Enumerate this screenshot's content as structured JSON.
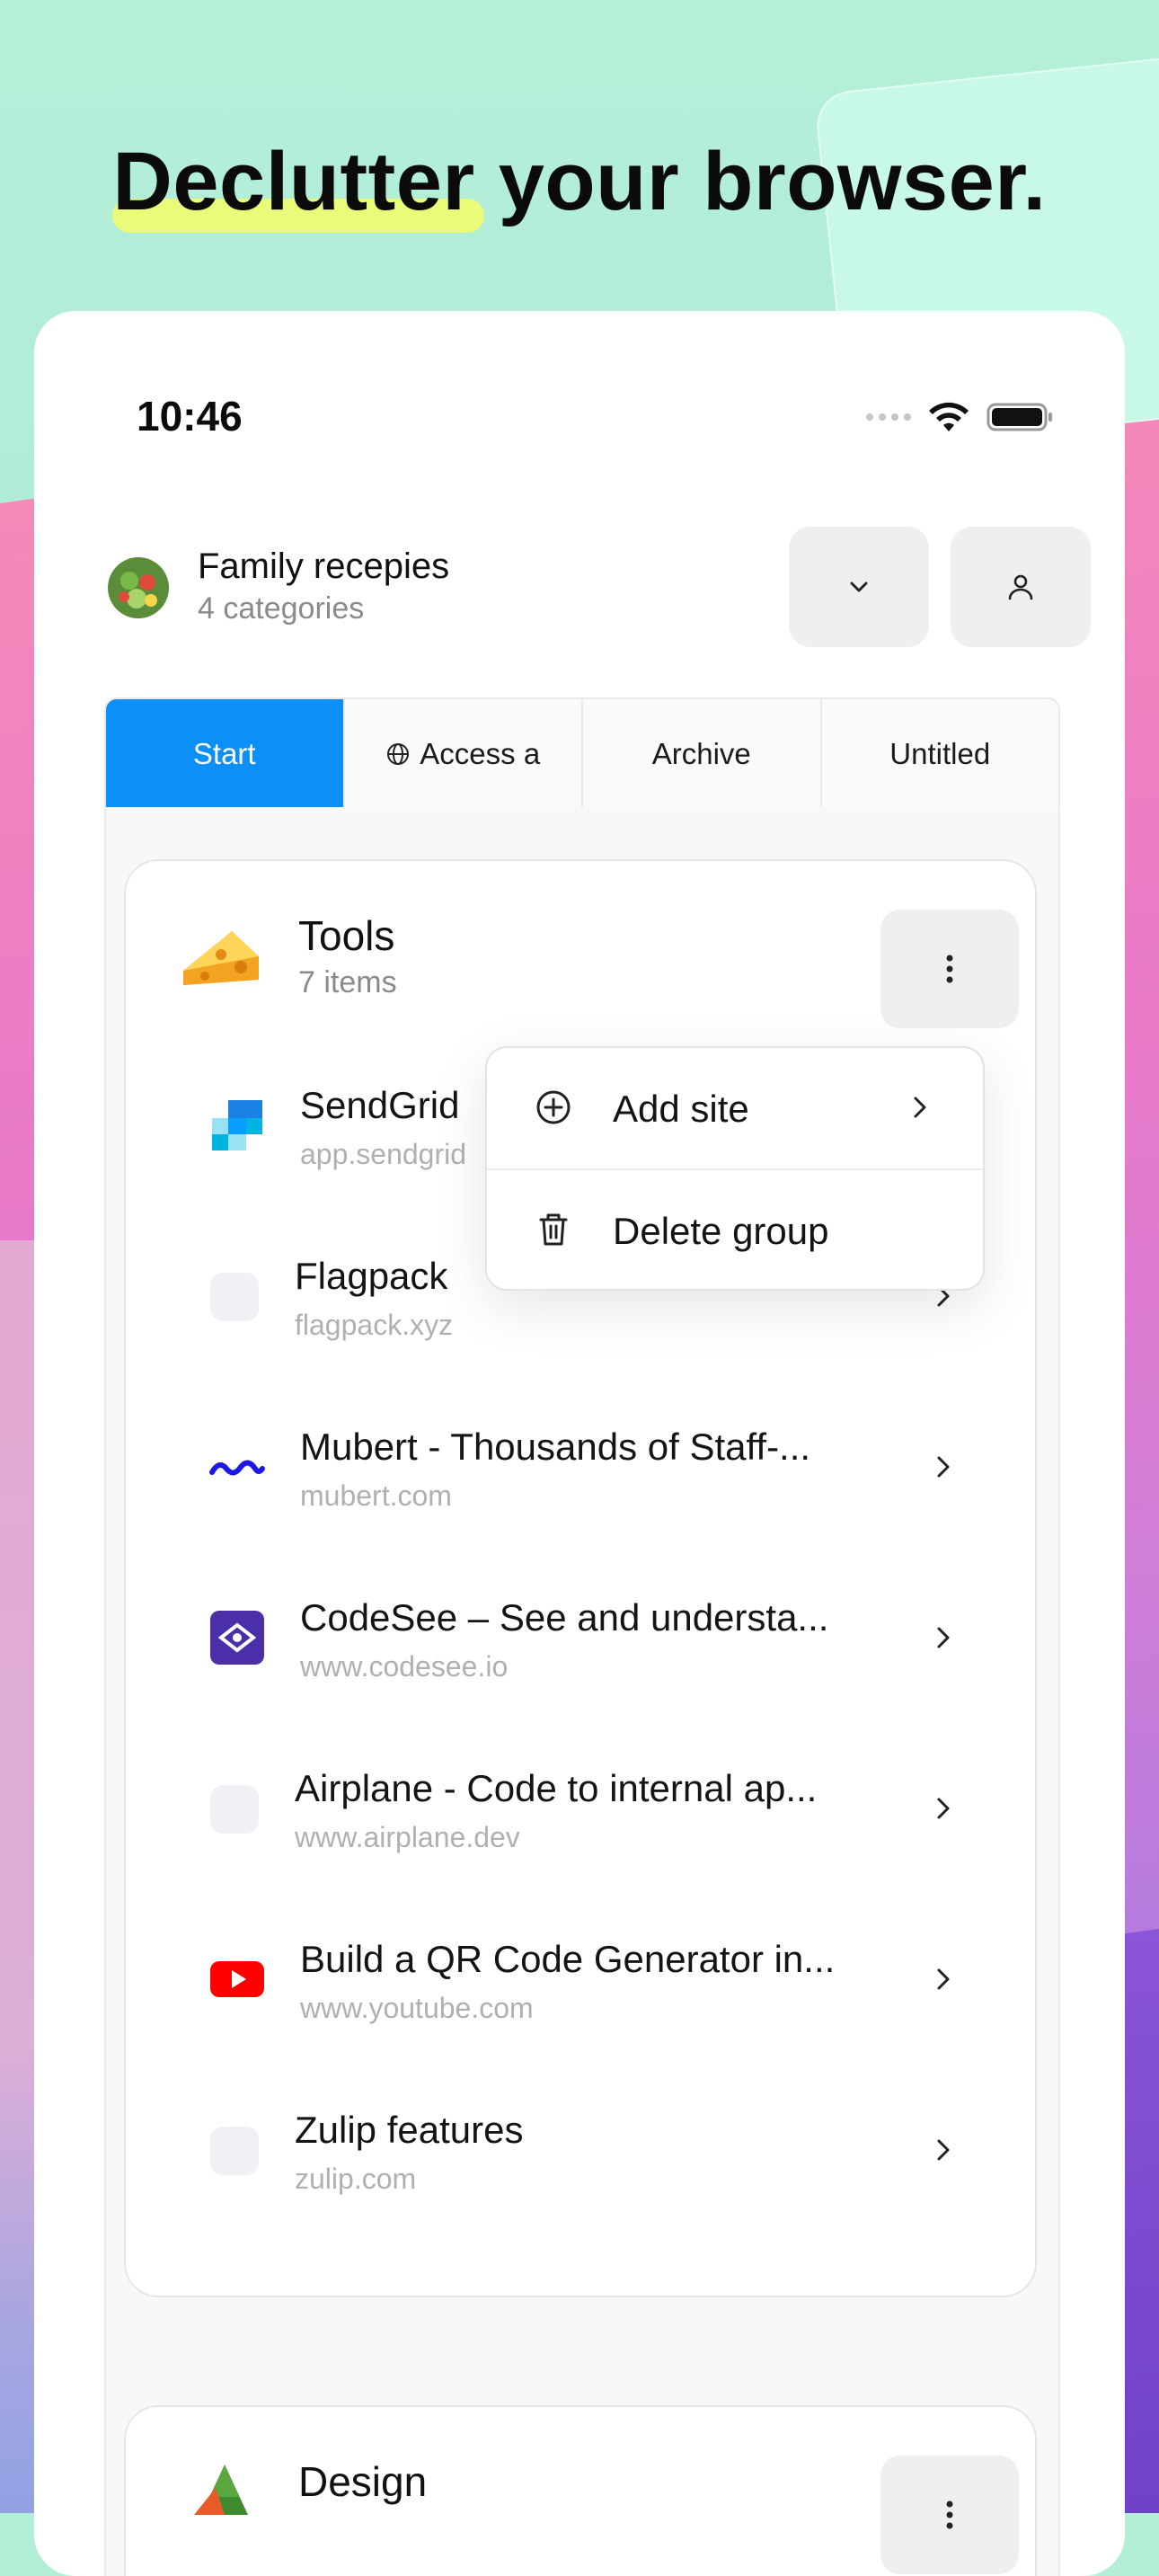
{
  "headline": {
    "highlight": "Declutter",
    "rest": " your browser."
  },
  "status_bar": {
    "time": "10:46"
  },
  "header": {
    "title": "Family recepies",
    "subtitle": "4 categories",
    "dropdown_icon": "chevron-down-icon",
    "profile_icon": "person-icon"
  },
  "tabs": [
    {
      "label": "Start",
      "active": true
    },
    {
      "label": "Access a",
      "icon": "globe-icon"
    },
    {
      "label": "Archive"
    },
    {
      "label": "Untitled"
    }
  ],
  "group": {
    "title": "Tools",
    "subtitle": "7 items",
    "icon": "cheese-icon",
    "items": [
      {
        "title": "SendGrid",
        "url": "app.sendgrid",
        "icon": "sendgrid-icon"
      },
      {
        "title": "Flagpack",
        "url": "flagpack.xyz",
        "icon": "placeholder"
      },
      {
        "title": "Mubert - Thousands of Staff-...",
        "url": "mubert.com",
        "icon": "mubert-icon"
      },
      {
        "title": "CodeSee – See and understa...",
        "url": "www.codesee.io",
        "icon": "codesee-icon"
      },
      {
        "title": "Airplane - Code to internal ap...",
        "url": "www.airplane.dev",
        "icon": "placeholder"
      },
      {
        "title": "Build a QR Code Generator in...",
        "url": "www.youtube.com",
        "icon": "youtube-icon"
      },
      {
        "title": "Zulip features",
        "url": "zulip.com",
        "icon": "placeholder"
      }
    ]
  },
  "context_menu": {
    "items": [
      {
        "label": "Add site",
        "icon": "plus-circle-icon",
        "has_submenu": true
      },
      {
        "label": "Delete group",
        "icon": "trash-icon"
      }
    ]
  },
  "group2": {
    "title": "Design",
    "icon": "tree-icon"
  },
  "colors": {
    "accent": "#0c8ff7",
    "highlight": "#e9fb78",
    "youtube": "#ff0000"
  }
}
